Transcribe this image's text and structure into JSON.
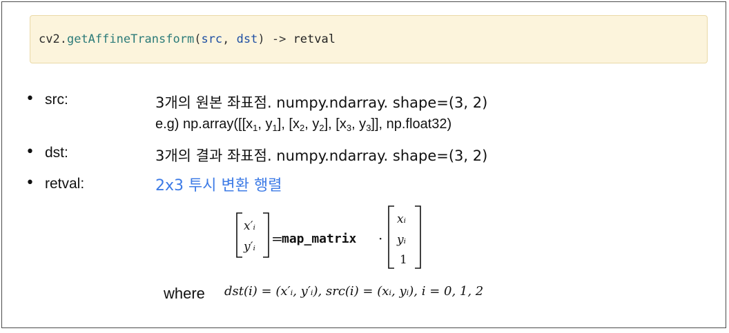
{
  "code": {
    "module": "cv2",
    "dot": ".",
    "function": "getAffineTransform",
    "open_paren": "(",
    "arg1": "src",
    "comma": ", ",
    "arg2": "dst",
    "close_arrow": ") -> ",
    "return": "retval"
  },
  "params": [
    {
      "bullet": "•",
      "name": "src:",
      "desc": "3개의 원본 좌표점. numpy.ndarray. shape=(3, 2)"
    },
    {
      "bullet": "•",
      "name": "dst:",
      "desc": "3개의 결과 좌표점. numpy.ndarray. shape=(3, 2)"
    },
    {
      "bullet": "•",
      "name": "retval:",
      "desc": "2x3 투시 변환 행렬"
    }
  ],
  "example": {
    "prefix": "e.g) np.array([[x",
    "s1": "1",
    "m1": ", y",
    "s2": "1",
    "m2": "], [x",
    "s3": "2",
    "m3": ", y",
    "s4": "2",
    "m4": "], [x",
    "s5": "3",
    "m5": ", y",
    "s6": "3",
    "suffix": "]], np.float32)"
  },
  "formula": {
    "lhs_top": "x′ᵢ",
    "lhs_bottom": "y′ᵢ",
    "equals": "=",
    "matrix_name": "map_matrix",
    "dot": "·",
    "rhs_top": "xᵢ",
    "rhs_mid": "yᵢ",
    "rhs_bottom": "1"
  },
  "where": {
    "word": "where",
    "expr": "dst(i) = (x′ᵢ, y′ᵢ), src(i) = (xᵢ, yᵢ), i = 0, 1, 2"
  },
  "colors": {
    "highlight_blue": "#3d7be6",
    "code_bg": "#fcf4dc"
  }
}
